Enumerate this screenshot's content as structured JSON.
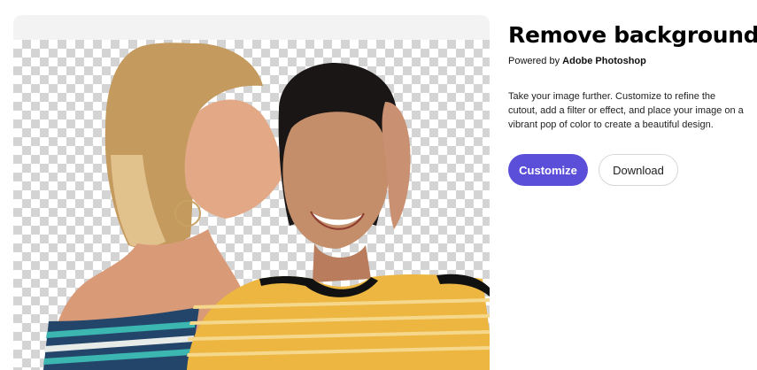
{
  "panel": {
    "title": "Remove background",
    "powered_prefix": "Powered by",
    "powered_brand": "Adobe Photoshop",
    "description": "Take your image further. Customize to refine the cutout, add a filter or effect, and place your image on a vibrant pop of color to create a beautiful design.",
    "customize_label": "Customize",
    "download_label": "Download"
  },
  "preview": {
    "subject": "photo-cutout",
    "background": "transparency-checkerboard"
  },
  "colors": {
    "accent": "#5b4fd9",
    "card": "#f3f3f3",
    "checker_dark": "#d4d4d4"
  }
}
